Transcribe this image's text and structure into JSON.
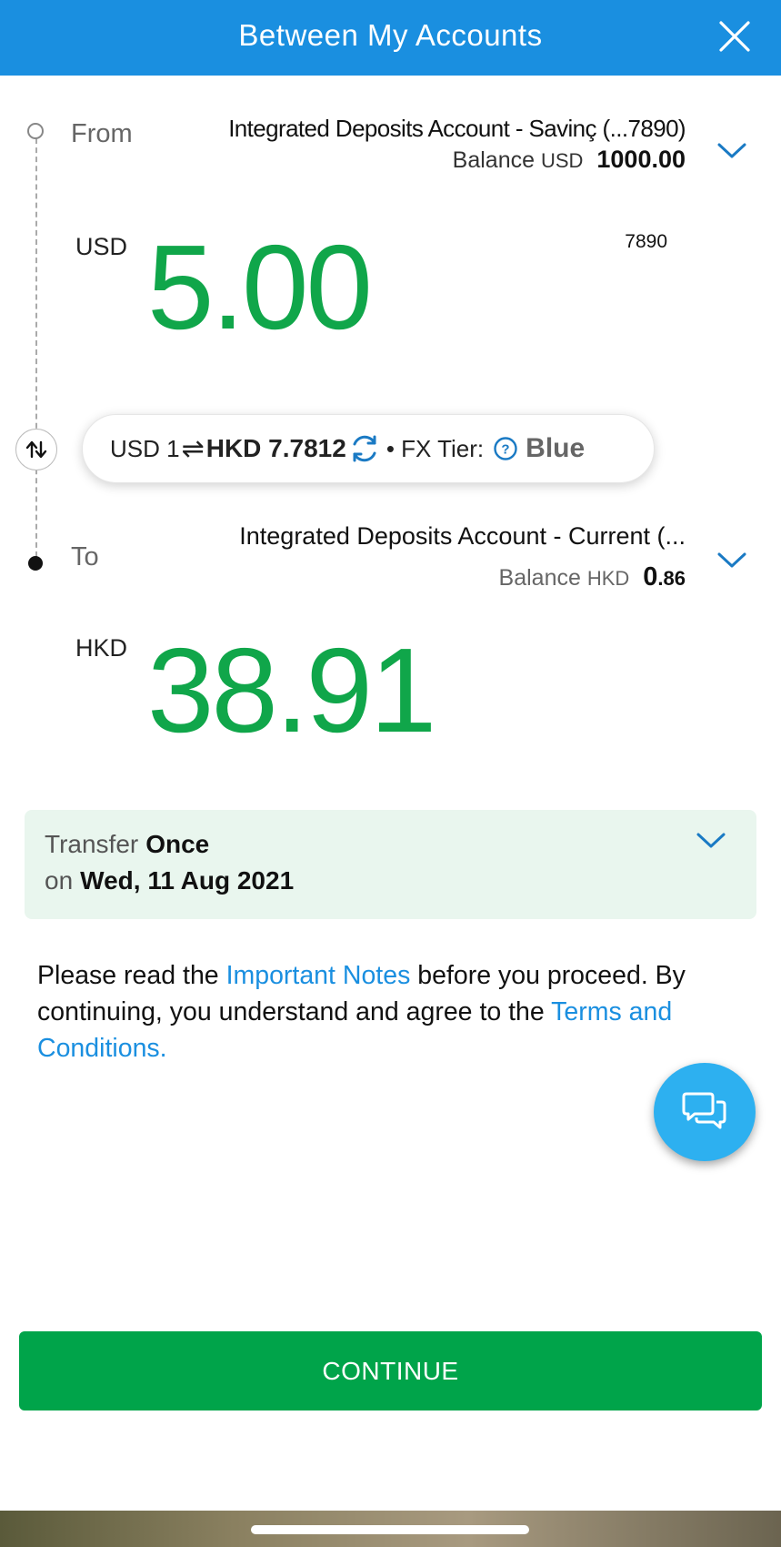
{
  "header": {
    "title": "Between My Accounts"
  },
  "from": {
    "label": "From",
    "account_name": "Integrated Deposits Account - Savinç (...7890)",
    "balance_label": "Balance",
    "balance_currency": "USD",
    "balance_value": "1000.00",
    "account_suffix": "7890",
    "amount_currency": "USD",
    "amount_value": "5.00"
  },
  "fx": {
    "from_text": "USD 1",
    "arrows": "⇌",
    "rate_text": "HKD 7.7812",
    "tier_label": "• FX Tier:",
    "tier_value": "Blue"
  },
  "to": {
    "label": "To",
    "account_name": "Integrated Deposits Account - Current (...",
    "balance_label": "Balance",
    "balance_currency": "HKD",
    "balance_int": "0",
    "balance_dec": ".86",
    "amount_currency": "HKD",
    "amount_value": "38.91"
  },
  "schedule": {
    "transfer_label": "Transfer",
    "frequency": "Once",
    "on_label": "on",
    "date": "Wed, 11 Aug 2021"
  },
  "notice": {
    "part1": "Please read the ",
    "link1": "Important Notes",
    "part2": " before you proceed. By continuing, you understand and agree to the ",
    "link2": "Terms and Conditions."
  },
  "continue_label": "CONTINUE",
  "colors": {
    "header": "#1a8fe0",
    "amount": "#10a64a",
    "button": "#00a44a",
    "link": "#1a8fe0"
  }
}
